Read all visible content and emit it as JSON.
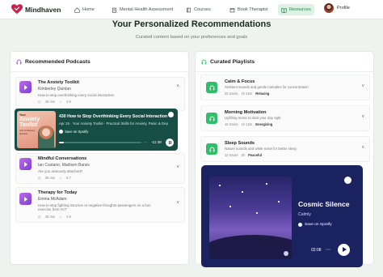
{
  "nav": {
    "brand": "Mindhaven",
    "items": [
      {
        "label": "Home",
        "icon": "home-icon"
      },
      {
        "label": "Mental Health Assessment",
        "icon": "clipboard-icon"
      },
      {
        "label": "Courses",
        "icon": "book-icon"
      },
      {
        "label": "Book Therapist",
        "icon": "calendar-icon"
      },
      {
        "label": "Resources",
        "icon": "book-open-icon",
        "active": true
      }
    ],
    "profile_label": "Profile"
  },
  "header": {
    "title": "Your Personalized Recommendations",
    "subtitle": "Curated content based on your preferences and goals"
  },
  "podcasts": {
    "title": "Recommended Podcasts",
    "items": [
      {
        "name": "The Anxiety Toolkit",
        "host": "Kimberley Quinlan",
        "desc": "How to stop overthinking every social interaction",
        "duration": "45 min",
        "rating": "4.9"
      },
      {
        "name": "Mindful Conversations",
        "host": "Ian Castano, Madisen Barsis",
        "desc": "Are you anxiously attached?",
        "duration": "35 min",
        "rating": "4.7"
      },
      {
        "name": "Therapy for Today",
        "host": "Emma McAdam",
        "desc": "How to stop fighting intrusive or negative thoughts-passengers on a bus exercise from ACT",
        "duration": "40 min",
        "rating": "4.9"
      }
    ],
    "embed": {
      "cover_line1": "Your",
      "cover_line2": "Anxiety Toolkit",
      "cover_line3": "with Kimberley Quinlan",
      "episode": "430 How to Stop Overthinking Every Social Interaction",
      "subtitle": "Apr 15 · Your Anxiety Toolkit - Practical Skills for Anxiety, Panic & Dep",
      "save_label": "Save on Spotify",
      "time": "-11:39",
      "progress": 0.06
    }
  },
  "playlists": {
    "title": "Curated Playlists",
    "items": [
      {
        "name": "Calm & Focus",
        "desc": "Ambient sounds and gentle melodies for concentration",
        "tracks": "25 tracks",
        "length": "1h 45m",
        "tag": "Relaxing",
        "expanded": false
      },
      {
        "name": "Morning Motivation",
        "desc": "Uplifting music to start your day right",
        "tracks": "18 tracks",
        "length": "1h 15m",
        "tag": "Energizing",
        "expanded": false
      },
      {
        "name": "Sleep Sounds",
        "desc": "Nature sounds and white noise for better sleep",
        "tracks": "12 tracks",
        "length": "8h",
        "tag": "Peaceful",
        "expanded": true
      }
    ],
    "embed": {
      "title": "Cosmic Silence",
      "artist": "Calmly",
      "save_label": "Save on Spotify",
      "time": "02:08"
    }
  },
  "colors": {
    "accent": "#2fbf6a",
    "podcast_thumb": "#9b4fe0",
    "podcast_embed": "#164d44",
    "playlist_embed": "#1a2260"
  }
}
